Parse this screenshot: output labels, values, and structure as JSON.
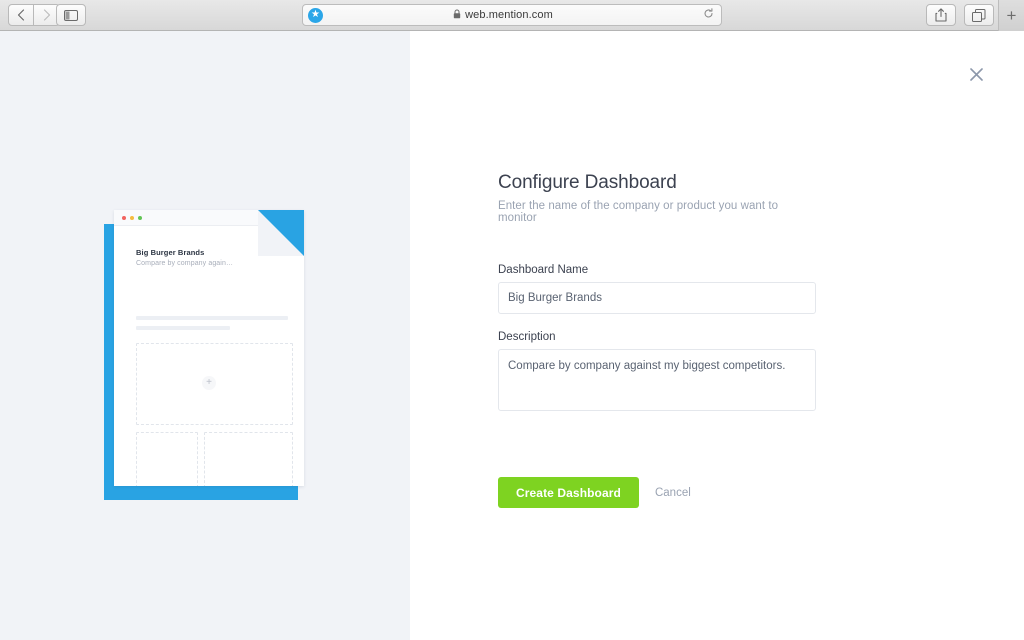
{
  "browser": {
    "back_icon": "chevron-left-icon",
    "forward_icon": "chevron-right-icon",
    "sidebar_icon": "sidebar-toggle-icon",
    "bookmark_icon": "star-icon",
    "lock_icon": "lock-icon",
    "url": "web.mention.com",
    "reload_icon": "reload-icon",
    "share_icon": "share-icon",
    "tabs_icon": "tabs-icon",
    "newtab_label": "+"
  },
  "illustration": {
    "card_title": "Big Burger Brands",
    "card_subtitle": "Compare by company again…",
    "add_widget_label": "+",
    "accent_color": "#29a3e3"
  },
  "modal": {
    "close_icon": "close-icon",
    "title": "Configure Dashboard",
    "subtitle": "Enter the name of the company or product you want to monitor",
    "fields": {
      "name": {
        "label": "Dashboard Name",
        "value": "Big Burger Brands",
        "placeholder": "Dashboard Name"
      },
      "description": {
        "label": "Description",
        "value": "Compare by company against my biggest competitors.",
        "placeholder": "Description"
      }
    },
    "primary_button": "Create Dashboard",
    "cancel_button": "Cancel",
    "primary_color": "#7ed321"
  }
}
